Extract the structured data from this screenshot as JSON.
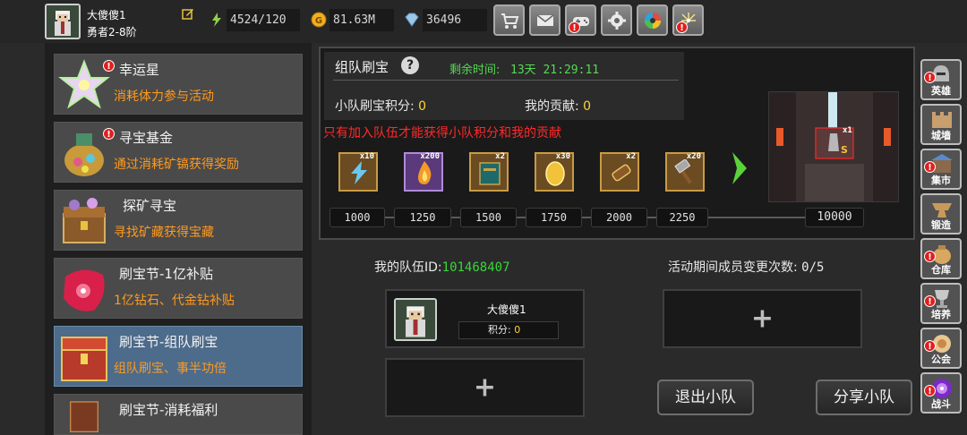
{
  "player": {
    "name": "大傻傻1",
    "rank": "勇者2-8阶"
  },
  "resources": {
    "stamina": "4524/120",
    "gold": "81.63M",
    "diamond": "36496"
  },
  "top_buttons": [
    "shop",
    "mail",
    "gamepad",
    "settings",
    "color-wheel",
    "fireworks"
  ],
  "left_list": [
    {
      "title": "幸运星",
      "desc": "消耗体力参与活动",
      "badge": "!"
    },
    {
      "title": "寻宝基金",
      "desc": "通过消耗矿镐获得奖励",
      "badge": "!"
    },
    {
      "title": "探矿寻宝",
      "desc": "寻找矿藏获得宝藏"
    },
    {
      "title": "刷宝节-1亿补贴",
      "desc": "1亿钻石、代金钻补贴"
    },
    {
      "title": "刷宝节-组队刷宝",
      "desc": "组队刷宝、事半功倍",
      "active": true
    },
    {
      "title": "刷宝节-消耗福利",
      "desc": ""
    }
  ],
  "panel": {
    "title": "组队刷宝",
    "help": "?",
    "time_label": "剩余时间:",
    "time_value": "13天 21:29:11",
    "team_score_label": "小队刷宝积分:",
    "team_score_value": "0",
    "my_contrib_label": "我的贡献:",
    "my_contrib_value": "0",
    "warning": "只有加入队伍才能获得小队积分和我的贡献"
  },
  "rewards": [
    {
      "icon": "lightning-icon",
      "qty": "x10"
    },
    {
      "icon": "flame-icon",
      "qty": "x200"
    },
    {
      "icon": "book-icon",
      "qty": "x2"
    },
    {
      "icon": "egg-icon",
      "qty": "x30"
    },
    {
      "icon": "scroll-icon",
      "qty": "x2"
    },
    {
      "icon": "hammer-icon",
      "qty": "x20"
    }
  ],
  "scene_reward": {
    "qty": "x1",
    "grade": "S"
  },
  "milestones": [
    "1000",
    "1250",
    "1500",
    "1750",
    "2000",
    "2250",
    "10000"
  ],
  "team": {
    "id_label": "我的队伍ID:",
    "id_value": "101468407",
    "change_label": "活动期间成员变更次数:",
    "change_value": "0/5",
    "member": {
      "name": "大傻傻1",
      "score_label": "积分:",
      "score_value": "0"
    },
    "add": "+",
    "leave": "退出小队",
    "share": "分享小队"
  },
  "right_nav": [
    {
      "label": "英雄",
      "badge": "!"
    },
    {
      "label": "城墙"
    },
    {
      "label": "集市",
      "badge": "!"
    },
    {
      "label": "锻造"
    },
    {
      "label": "仓库",
      "badge": "!"
    },
    {
      "label": "培养",
      "badge": "!"
    },
    {
      "label": "公会",
      "badge": "!"
    },
    {
      "label": "战斗",
      "badge": "!"
    }
  ],
  "colors": {
    "accent_orange": "#ff9a1f",
    "warning_red": "#ff2a2a",
    "timer_green": "#54d954",
    "id_green": "#3ad63a",
    "score_yellow": "#ffd23a"
  }
}
